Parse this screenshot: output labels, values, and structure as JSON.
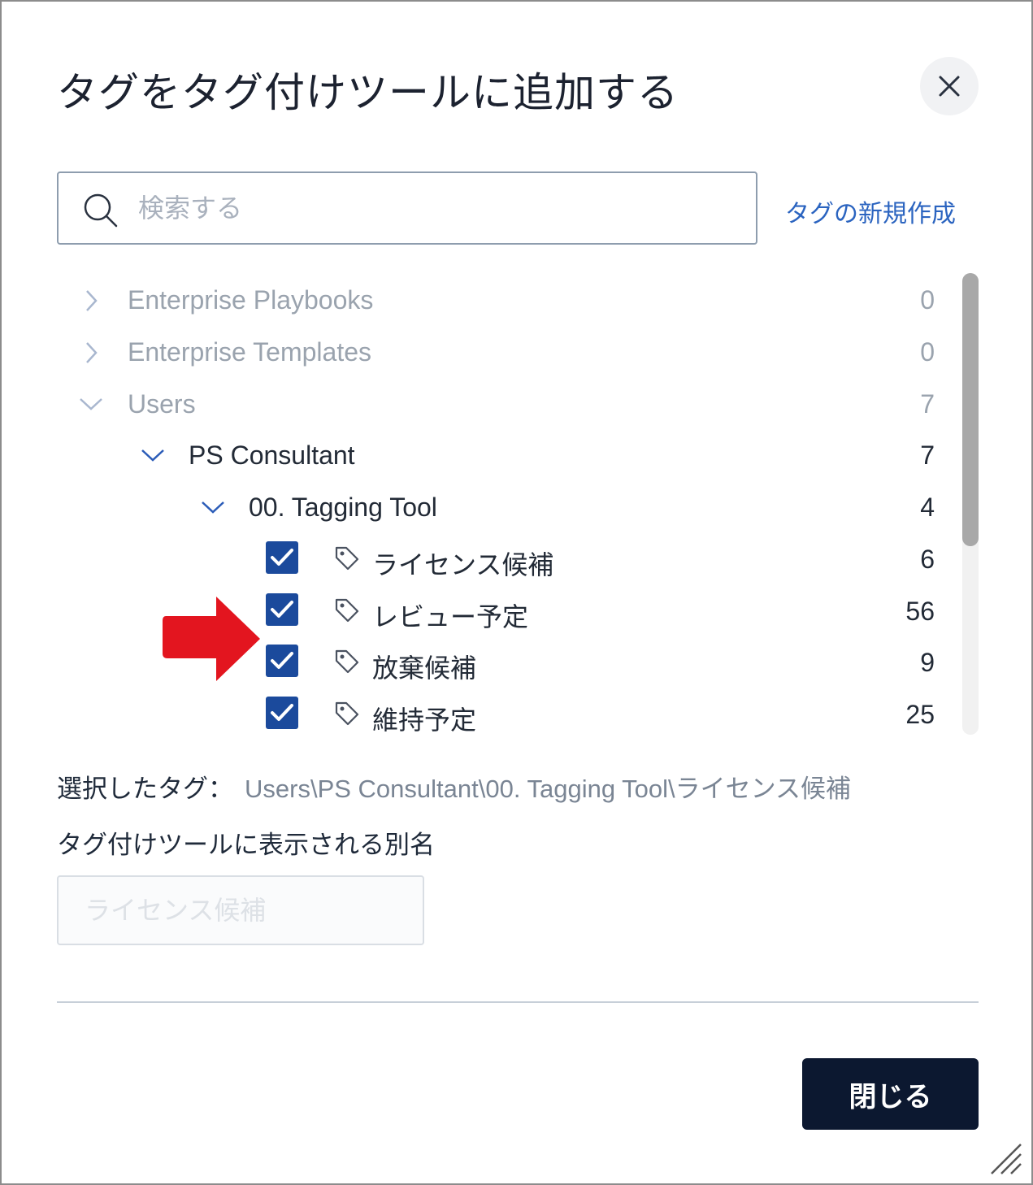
{
  "dialog": {
    "title": "タグをタグ付けツールに追加する",
    "close_icon": "close-icon"
  },
  "search": {
    "placeholder": "検索する",
    "value": ""
  },
  "new_tag_link": "タグの新規作成",
  "tree": {
    "nodes": [
      {
        "label": "Enterprise Playbooks",
        "count": "0",
        "expanded": false
      },
      {
        "label": "Enterprise Templates",
        "count": "0",
        "expanded": false
      },
      {
        "label": "Users",
        "count": "7",
        "expanded": true
      },
      {
        "label": "PS Consultant",
        "count": "7",
        "expanded": true
      },
      {
        "label": "00. Tagging Tool",
        "count": "4",
        "expanded": true
      }
    ],
    "tags": [
      {
        "label": "ライセンス候補",
        "count": "6",
        "checked": true
      },
      {
        "label": "レビュー予定",
        "count": "56",
        "checked": true
      },
      {
        "label": "放棄候補",
        "count": "9",
        "checked": true
      },
      {
        "label": "維持予定",
        "count": "25",
        "checked": true
      }
    ]
  },
  "selected": {
    "label": "選択したタグ：",
    "path": "Users\\PS Consultant\\00. Tagging Tool\\ライセンス候補"
  },
  "alias": {
    "label": "タグ付けツールに表示される別名",
    "placeholder": "ライセンス候補"
  },
  "footer": {
    "close_button": "閉じる"
  },
  "colors": {
    "accent": "#1b4a9c",
    "link": "#2b64c0",
    "primary_button": "#0c1830",
    "annotation_arrow": "#e3151f"
  }
}
